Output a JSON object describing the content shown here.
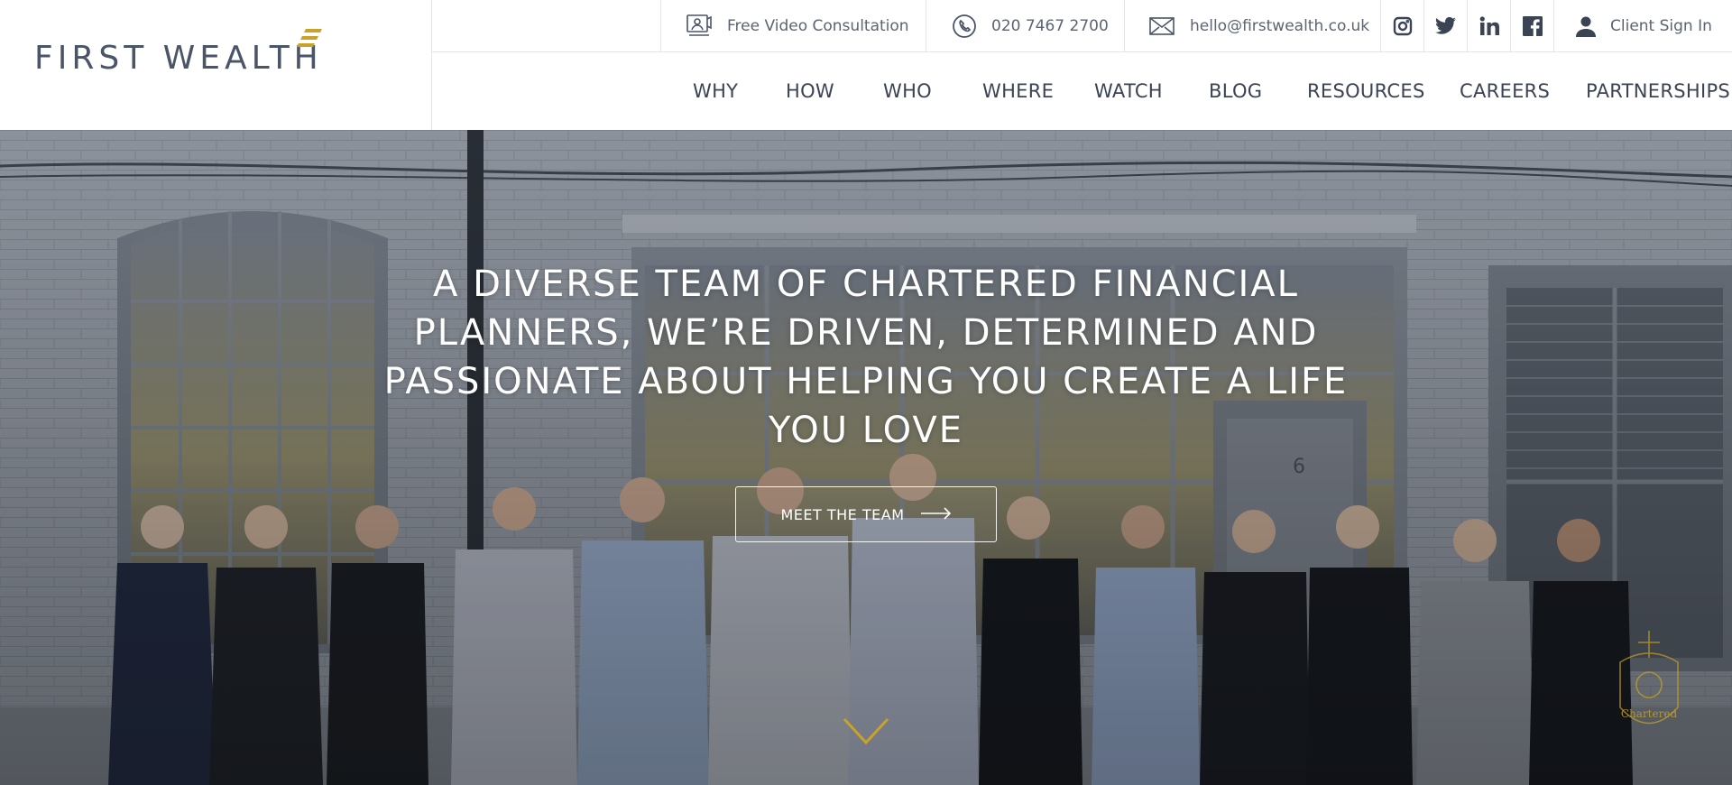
{
  "brand": {
    "name": "FIRST WEALTH",
    "accent": "#c9a227",
    "text_color": "#4a5568"
  },
  "topbar": {
    "consultation": {
      "label": "Free Video Consultation",
      "icon": "video-consultation-icon"
    },
    "phone": {
      "label": "020 7467 2700",
      "icon": "phone-icon"
    },
    "email": {
      "label": "hello@firstwealth.co.uk",
      "icon": "envelope-icon"
    },
    "social": [
      {
        "name": "instagram",
        "icon": "instagram-icon"
      },
      {
        "name": "twitter",
        "icon": "twitter-icon"
      },
      {
        "name": "linkedin",
        "icon": "linkedin-icon"
      },
      {
        "name": "facebook",
        "icon": "facebook-icon"
      }
    ],
    "signin": {
      "label": "Client Sign In",
      "icon": "user-icon"
    }
  },
  "nav": {
    "items": [
      "WHY",
      "HOW",
      "WHO",
      "WHERE",
      "WATCH",
      "BLOG",
      "RESOURCES",
      "CAREERS",
      "PARTNERSHIPS"
    ]
  },
  "hero": {
    "headline": "A DIVERSE TEAM OF CHARTERED FINANCIAL PLANNERS, WE’RE DRIVEN, DETERMINED AND PASSIONATE ABOUT HELPING YOU CREATE A LIFE YOU LOVE",
    "cta_label": "MEET THE TEAM",
    "badge_label": "Chartered",
    "door_number": "6"
  }
}
